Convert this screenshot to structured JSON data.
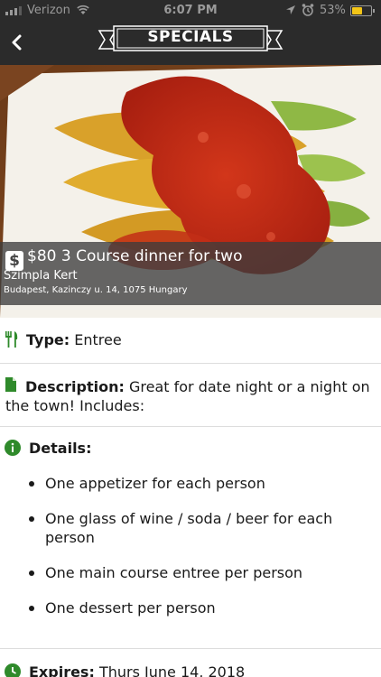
{
  "status_bar": {
    "carrier": "Verizon",
    "time": "6:07 PM",
    "battery_pct": "53%",
    "battery_level": 0.53,
    "battery_color": "#f3c517",
    "icons": [
      "signal-bars-icon",
      "wifi-icon",
      "location-arrow-icon",
      "alarm-icon",
      "battery-icon"
    ]
  },
  "nav": {
    "back_icon": "chevron-left-icon",
    "title": "SPECIALS"
  },
  "deal": {
    "price_icon": "dollar-sign-icon",
    "title": "$80 3 Course dinner for two",
    "venue": "Szimpla Kert",
    "address": "Budapest, Kazinczy u. 14, 1075 Hungary"
  },
  "type": {
    "icon": "fork-knife-icon",
    "label": "Type:",
    "value": "Entree"
  },
  "description": {
    "icon": "document-icon",
    "label": "Description:",
    "value": "Great for date night or a night on the town! Includes:"
  },
  "details": {
    "icon": "info-circle-icon",
    "label": "Details:",
    "items": [
      "One appetizer for each person",
      "One glass of wine / soda / beer for each person",
      "One main course entree per person",
      "One dessert per person"
    ]
  },
  "expires": {
    "icon": "clock-icon",
    "label": "Expires:",
    "value": "Thurs June 14, 2018"
  },
  "colors": {
    "nav_background": "#2b2b2b",
    "icon_green": "#2f8a2b"
  }
}
